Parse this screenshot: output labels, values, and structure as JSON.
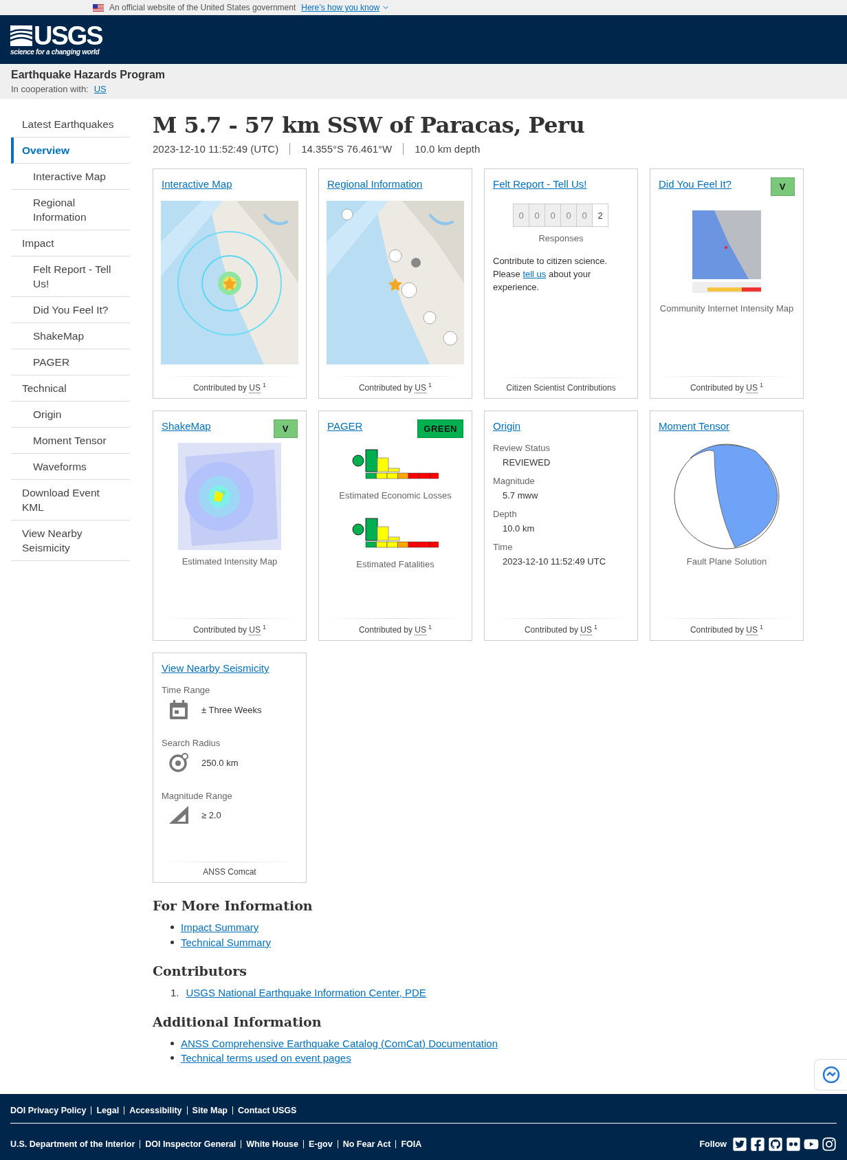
{
  "gov_banner": {
    "text": "An official website of the United States government",
    "link": "Here’s how you know"
  },
  "logo": {
    "name": "USGS",
    "tagline": "science for a changing world"
  },
  "program": {
    "title": "Earthquake Hazards Program",
    "cooperation_label": "In cooperation with:",
    "cooperation_link": "US"
  },
  "sidebar": {
    "items": [
      {
        "label": "Latest Earthquakes",
        "selected": false
      },
      {
        "label": "Overview",
        "selected": true,
        "children": [
          {
            "label": "Interactive Map",
            "selected": false
          },
          {
            "label": "Regional Information",
            "selected": false
          }
        ]
      },
      {
        "label": "Impact",
        "selected": false,
        "children": [
          {
            "label": "Felt Report - Tell Us!",
            "selected": false
          },
          {
            "label": "Did You Feel It?",
            "selected": false
          },
          {
            "label": "ShakeMap",
            "selected": false
          },
          {
            "label": "PAGER",
            "selected": false
          }
        ]
      },
      {
        "label": "Technical",
        "selected": false,
        "children": [
          {
            "label": "Origin",
            "selected": false
          },
          {
            "label": "Moment Tensor",
            "selected": false
          },
          {
            "label": "Waveforms",
            "selected": false
          }
        ]
      },
      {
        "label": "Download Event KML",
        "selected": false
      },
      {
        "label": "View Nearby Seismicity",
        "selected": false
      }
    ]
  },
  "event": {
    "title": "M 5.7 - 57 km SSW of Paracas, Peru",
    "meta": [
      "2023-12-10 11:52:49 (UTC)",
      "14.355°S 76.461°W",
      "10.0 km depth"
    ]
  },
  "cards": [
    {
      "kind": "map",
      "title": "Interactive Map",
      "footer": {
        "prefix": "Contributed by",
        "source": "US",
        "note": "1"
      }
    },
    {
      "kind": "regional",
      "title": "Regional Information",
      "footer": {
        "prefix": "Contributed by",
        "source": "US",
        "note": "1"
      }
    },
    {
      "kind": "felt",
      "title": "Felt Report - Tell Us!",
      "counter": [
        "0",
        "0",
        "0",
        "0",
        "0",
        "2"
      ],
      "counter_label": "Responses",
      "text": "Contribute to citizen science. Please ",
      "link": "tell us",
      "text_after": " about your experience.",
      "footer": {
        "prefix": "Citizen Scientist Contributions"
      }
    },
    {
      "kind": "dyfi",
      "title": "Did You Feel It?",
      "badge": {
        "label": "V",
        "color": "#7ac87a"
      },
      "caption": "Community Internet Intensity Map",
      "footer": {
        "prefix": "Contributed by",
        "source": "US",
        "note": "1"
      }
    },
    {
      "kind": "shakemap",
      "title": "ShakeMap",
      "badge": {
        "label": "V",
        "color": "#7ac87a"
      },
      "caption": "Estimated Intensity Map",
      "footer": {
        "prefix": "Contributed by",
        "source": "US",
        "note": "1"
      }
    },
    {
      "kind": "pager",
      "title": "PAGER",
      "badge": {
        "label": "GREEN",
        "color": "#00b050"
      },
      "captions": [
        "Estimated Economic Losses",
        "Estimated Fatalities"
      ],
      "footer": {
        "prefix": "Contributed by",
        "source": "US",
        "note": "1"
      }
    },
    {
      "kind": "origin",
      "title": "Origin",
      "fields": [
        {
          "label": "Review Status",
          "value": "REVIEWED"
        },
        {
          "label": "Magnitude",
          "value": "5.7 mww"
        },
        {
          "label": "Depth",
          "value": "10.0 km"
        },
        {
          "label": "Time",
          "value": "2023-12-10 11:52:49 UTC"
        }
      ],
      "footer": {
        "prefix": "Contributed by",
        "source": "US",
        "note": "1"
      }
    },
    {
      "kind": "tensor",
      "title": "Moment Tensor",
      "caption": "Fault Plane Solution",
      "footer": {
        "prefix": "Contributed by",
        "source": "US",
        "note": "1"
      }
    },
    {
      "kind": "nearby",
      "title": "View Nearby Seismicity",
      "rows": [
        {
          "label": "Time Range",
          "kind": "calendar",
          "value": "± Three Weeks"
        },
        {
          "label": "Search Radius",
          "kind": "radius",
          "value": "250.0 km"
        },
        {
          "label": "Magnitude Range",
          "kind": "magnitude",
          "value": "≥ 2.0"
        }
      ],
      "footer": {
        "prefix": "ANSS Comcat"
      }
    }
  ],
  "sections": [
    {
      "title": "For More Information",
      "kind": "bullets",
      "links": [
        {
          "text": "Impact Summary"
        },
        {
          "text": "Technical Summary"
        }
      ]
    },
    {
      "title": "Contributors",
      "kind": "numbered",
      "links": [
        {
          "number": "1.",
          "text": "USGS National Earthquake Information Center, PDE"
        }
      ]
    },
    {
      "title": "Additional Information",
      "kind": "bullets",
      "links": [
        {
          "text": "ANSS Comprehensive Earthquake Catalog (ComCat) Documentation"
        },
        {
          "text": "Technical terms used on event pages"
        }
      ]
    }
  ],
  "footer": {
    "row1": [
      "DOI Privacy Policy",
      "Legal",
      "Accessibility",
      "Site Map",
      "Contact USGS"
    ],
    "row2": [
      "U.S. Department of the Interior",
      "DOI Inspector General",
      "White House",
      "E-gov",
      "No Fear Act",
      "FOIA"
    ],
    "follow": "Follow"
  }
}
